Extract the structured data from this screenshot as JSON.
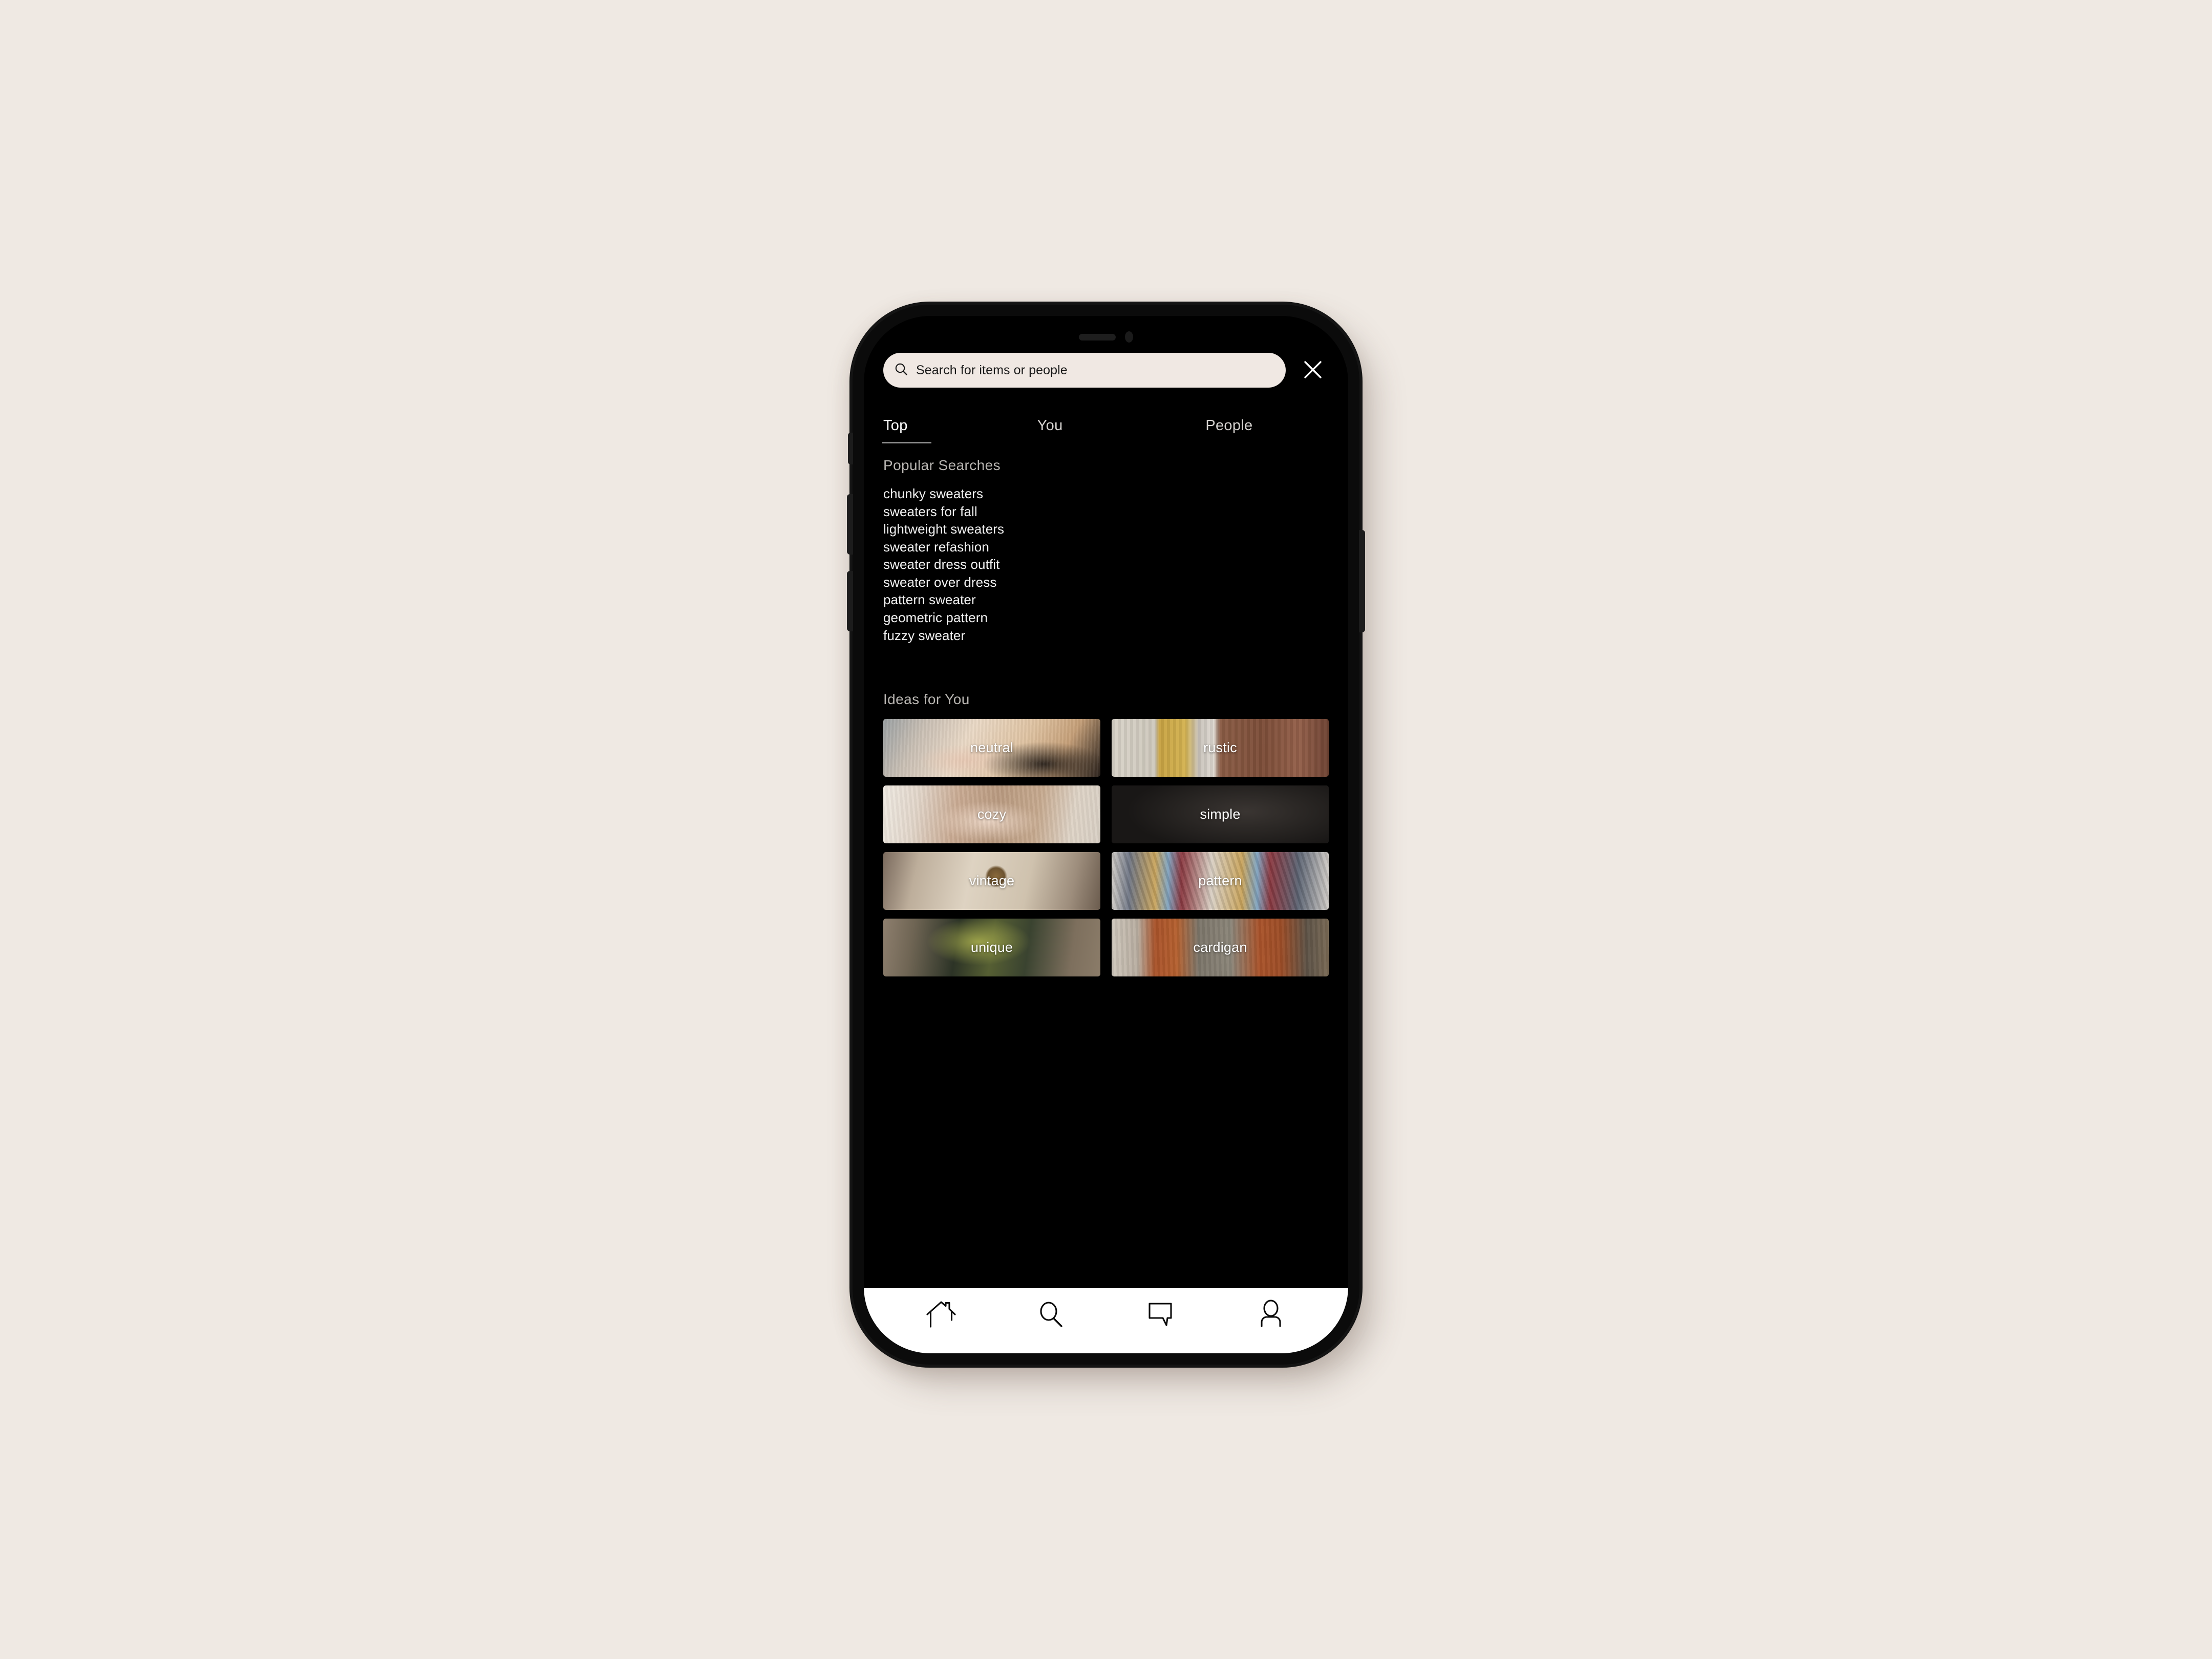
{
  "app": {
    "background_color": "#efe9e3",
    "screen_background": "#000000",
    "accent_cream": "#f0e8e3"
  },
  "device": {
    "speaker_slot": "speaker-slot",
    "front_camera": "front-camera",
    "buttons": [
      "silent-switch",
      "volume-up",
      "volume-down",
      "power"
    ]
  },
  "search": {
    "placeholder": "Search for items or people",
    "value": "",
    "icon": "search-icon",
    "close_icon": "close-icon"
  },
  "tabs": [
    {
      "label": "Top",
      "active": true
    },
    {
      "label": "You",
      "active": false
    },
    {
      "label": "People",
      "active": false
    }
  ],
  "popular": {
    "title": "Popular Searches",
    "items": [
      "chunky sweaters",
      "sweaters for fall",
      "lightweight sweaters",
      "sweater refashion",
      "sweater dress outfit",
      "sweater over dress",
      "pattern sweater",
      "geometric pattern",
      "fuzzy sweater"
    ]
  },
  "ideas": {
    "title": "Ideas for You",
    "tiles": [
      {
        "label": "neutral",
        "image": "cream-knit-sweater-held-in-arms"
      },
      {
        "label": "rustic",
        "image": "mustard-knit-against-rusty-wood"
      },
      {
        "label": "cozy",
        "image": "taupe-chunky-cardigan-hands-clasped"
      },
      {
        "label": "simple",
        "image": "dark-fabric-with-flower-motif"
      },
      {
        "label": "vintage",
        "image": "cream-sweatshirt-with-round-graphic"
      },
      {
        "label": "pattern",
        "image": "fair-isle-patterned-sweater"
      },
      {
        "label": "unique",
        "image": "olive-textured-knit-collar"
      },
      {
        "label": "cardigan",
        "image": "rust-orange-long-cardigan"
      }
    ]
  },
  "bottom_nav": [
    {
      "label": "Home",
      "icon": "home-icon"
    },
    {
      "label": "Search",
      "icon": "search-icon"
    },
    {
      "label": "Messages",
      "icon": "message-bubble-icon"
    },
    {
      "label": "Profile",
      "icon": "person-icon"
    }
  ]
}
